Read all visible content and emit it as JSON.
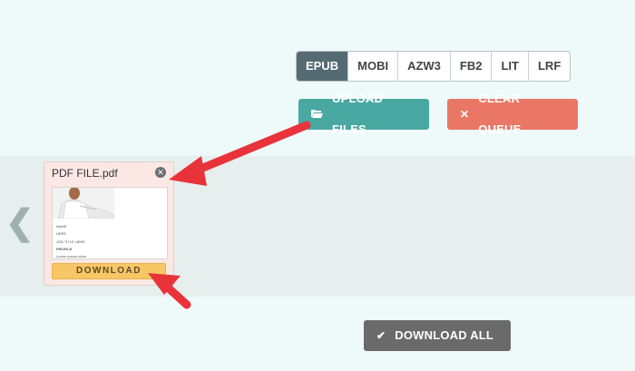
{
  "formats": [
    {
      "label": "EPUB",
      "active": true
    },
    {
      "label": "MOBI",
      "active": false
    },
    {
      "label": "AZW3",
      "active": false
    },
    {
      "label": "FB2",
      "active": false
    },
    {
      "label": "LIT",
      "active": false
    },
    {
      "label": "LRF",
      "active": false
    }
  ],
  "actions": {
    "upload_label": "UPLOAD FILES",
    "clear_label": "CLEAR QUEUE",
    "download_all_label": "DOWNLOAD ALL"
  },
  "queue": {
    "prev_arrow": "❮",
    "file": {
      "name": "PDF FILE.pdf",
      "download_label": "DOWNLOAD",
      "thumb_lines": [
        "NAME",
        "HERE",
        "JOB TITLE HERE",
        "PROFILE",
        "Lorem ipsum dolor"
      ]
    }
  },
  "colors": {
    "active_tab": "#546b73",
    "upload": "#4aa8a2",
    "clear": "#ea7766",
    "download_all": "#6a6a6a",
    "download": "#f8c765",
    "annotation_arrow": "#e8333a"
  },
  "icons": {
    "upload": "folder-open-icon",
    "clear": "x-icon",
    "download_all": "checkmark-icon",
    "remove": "close-circle-icon",
    "prev": "chevron-left-icon"
  }
}
